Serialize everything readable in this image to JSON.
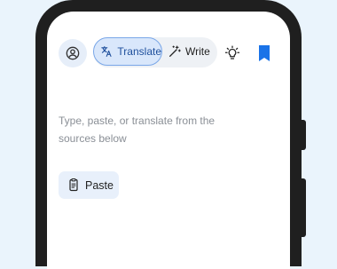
{
  "header": {
    "tabs": [
      {
        "label": "Translate",
        "icon": "translate-icon",
        "selected": true
      },
      {
        "label": "Write",
        "icon": "magic-wand-icon",
        "selected": false
      }
    ],
    "icons": [
      "account-circle-icon",
      "lightbulb-icon",
      "bookmark-icon"
    ]
  },
  "input": {
    "placeholder": "Type, paste, or translate from the sources below"
  },
  "paste": {
    "label": "Paste",
    "icon": "clipboard-icon"
  },
  "colors": {
    "background": "#eaf4fc",
    "frame": "#1f1f1f",
    "accent": "#1a73e8",
    "selected_tab_bg": "#d9e7fb",
    "paste_bg": "#e8f0fb"
  }
}
